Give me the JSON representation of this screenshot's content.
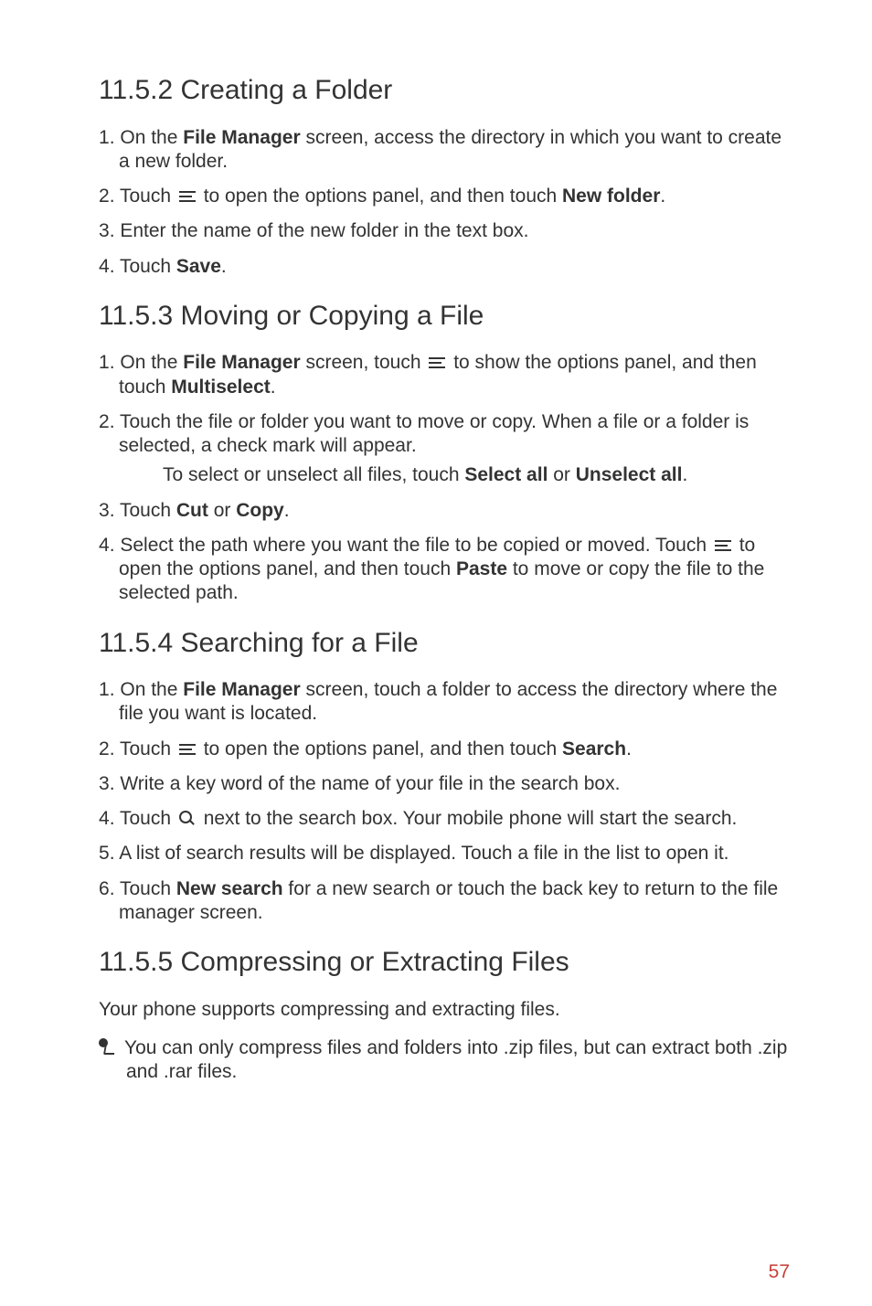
{
  "sections": {
    "s1": {
      "heading": "11.5.2  Creating a Folder",
      "i1a": "On the ",
      "i1b": "File Manager",
      "i1c": " screen, access the directory in which you want to create a new folder.",
      "i2a": "Touch ",
      "i2b": " to open the options panel, and then touch ",
      "i2c": "New folder",
      "i2d": ".",
      "i3": "Enter the name of the new folder in the text box.",
      "i4a": "Touch ",
      "i4b": "Save",
      "i4c": "."
    },
    "s2": {
      "heading": "11.5.3  Moving or Copying a File",
      "i1a": "On the ",
      "i1b": "File Manager",
      "i1c": " screen, touch ",
      "i1d": " to show the options panel, and then touch ",
      "i1e": "Multiselect",
      "i1f": ".",
      "i2": "Touch the file or folder you want to move or copy. When a file or a folder is selected, a check mark will appear.",
      "sub2a": "To select or unselect all files, touch ",
      "sub2b": "Select all",
      "sub2c": " or ",
      "sub2d": "Unselect all",
      "sub2e": ".",
      "i3a": "Touch ",
      "i3b": "Cut",
      "i3c": " or ",
      "i3d": "Copy",
      "i3e": ".",
      "i4a": "Select the path where you want the file to be copied or moved. Touch ",
      "i4b": " to open the options panel, and then touch ",
      "i4c": "Paste",
      "i4d": " to move or copy the file to the selected path."
    },
    "s3": {
      "heading": "11.5.4  Searching for a File",
      "i1a": "On the ",
      "i1b": "File Manager",
      "i1c": " screen, touch a folder to access the directory where the file you want is located.",
      "i2a": "Touch ",
      "i2b": " to open the options panel, and then touch ",
      "i2c": "Search",
      "i2d": ".",
      "i3": "Write a key word of the name of your file in the search box.",
      "i4a": "Touch ",
      "i4b": " next to the search box. Your mobile phone will start the search.",
      "i5": "A list of search results will be displayed. Touch a file in the list to open it.",
      "i6a": "Touch ",
      "i6b": "New search",
      "i6c": " for a new search or touch the back key to return to the file manager screen."
    },
    "s4": {
      "heading": "11.5.5  Compressing or Extracting Files",
      "intro": "Your phone supports compressing and extracting files.",
      "note": "You can only compress files and folders into .zip files, but can extract both .zip and .rar files."
    }
  },
  "page_number": "57"
}
